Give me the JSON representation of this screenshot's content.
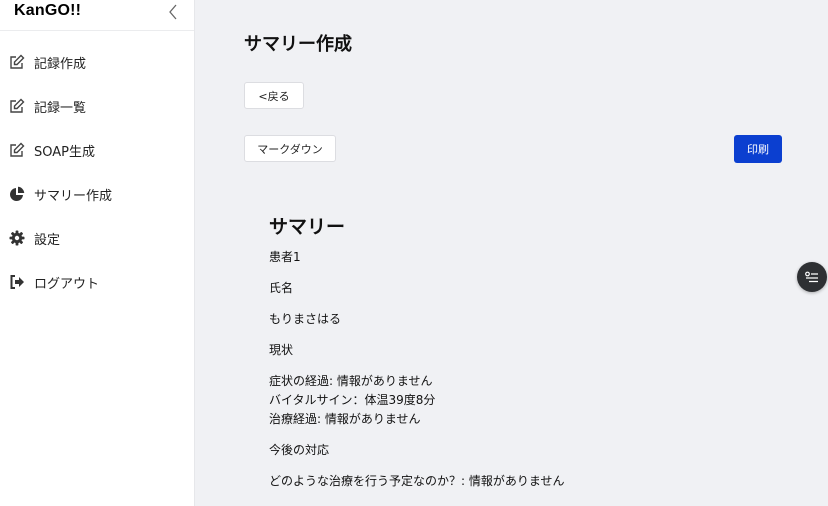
{
  "app": {
    "brand": "KanGO!!"
  },
  "sidebar": {
    "items": [
      {
        "label": "記録作成",
        "icon": "edit-icon"
      },
      {
        "label": "記録一覧",
        "icon": "edit-icon"
      },
      {
        "label": "SOAP生成",
        "icon": "edit-icon"
      },
      {
        "label": "サマリー作成",
        "icon": "pie-chart-icon"
      },
      {
        "label": "設定",
        "icon": "gear-icon"
      },
      {
        "label": "ログアウト",
        "icon": "logout-icon"
      }
    ]
  },
  "main": {
    "title": "サマリー作成",
    "back_label": "<戻る",
    "markdown_label": "マークダウン",
    "print_label": "印刷",
    "summary": {
      "heading": "サマリー",
      "patient": "患者1",
      "name_label": "氏名",
      "name_value": "もりまさはる",
      "status_label": "現状",
      "status_lines": [
        "症状の経過: 情報がありません",
        "バイタルサイン：体温39度8分",
        "治療経過: 情報がありません"
      ],
      "future_label": "今後の対応",
      "future_line": "どのような治療を行う予定なのか？: 情報がありません"
    }
  },
  "colors": {
    "primary": "#0b3fd0",
    "sidebar_bg": "#ffffff",
    "main_bg": "#f0f1f4"
  }
}
